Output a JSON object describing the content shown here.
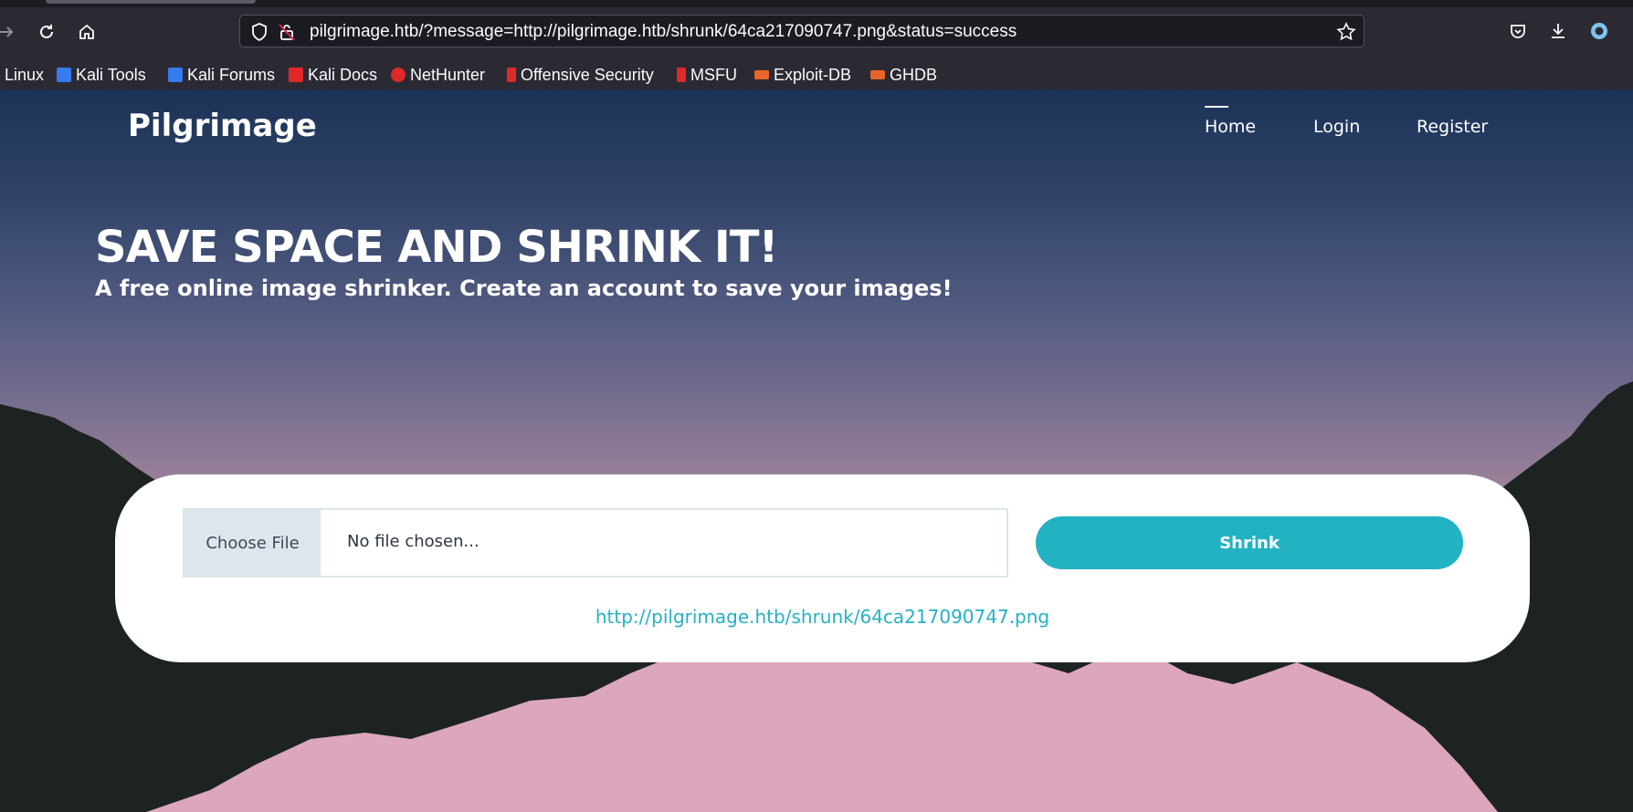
{
  "browser": {
    "url": "pilgrimage.htb/?message=http://pilgrimage.htb/shrunk/64ca217090747.png&status=success",
    "bookmarks": [
      {
        "label": "i Linux",
        "icon": "kali-icon",
        "color": "#367bf0"
      },
      {
        "label": "Kali Tools",
        "icon": "kali-tools-icon",
        "color": "#367bf0"
      },
      {
        "label": "Kali Forums",
        "icon": "kali-forums-icon",
        "color": "#367bf0"
      },
      {
        "label": "Kali Docs",
        "icon": "kali-docs-icon",
        "color": "#e02828"
      },
      {
        "label": "NetHunter",
        "icon": "nethunter-icon",
        "color": "#e02828"
      },
      {
        "label": "Offensive Security",
        "icon": "offsec-icon",
        "color": "#e02828"
      },
      {
        "label": "MSFU",
        "icon": "msfu-icon",
        "color": "#e02828"
      },
      {
        "label": "Exploit-DB",
        "icon": "exploitdb-icon",
        "color": "#e8652b"
      },
      {
        "label": "GHDB",
        "icon": "ghdb-icon",
        "color": "#e8652b"
      }
    ]
  },
  "site": {
    "logo": "Pilgrimage",
    "nav": {
      "home": "Home",
      "login": "Login",
      "register": "Register"
    },
    "hero": {
      "title": "SAVE SPACE AND SHRINK IT!",
      "subtitle": "A free online image shrinker. Create an account to save your images!"
    },
    "form": {
      "choose_file": "Choose File",
      "file_status": "No file chosen...",
      "submit": "Shrink",
      "result_link": "http://pilgrimage.htb/shrunk/64ca217090747.png"
    },
    "colors": {
      "accent": "#23b2c2",
      "mountains": "#1c2321",
      "sky_top": "#1b3357",
      "sky_bottom": "#cc9fb1"
    }
  }
}
